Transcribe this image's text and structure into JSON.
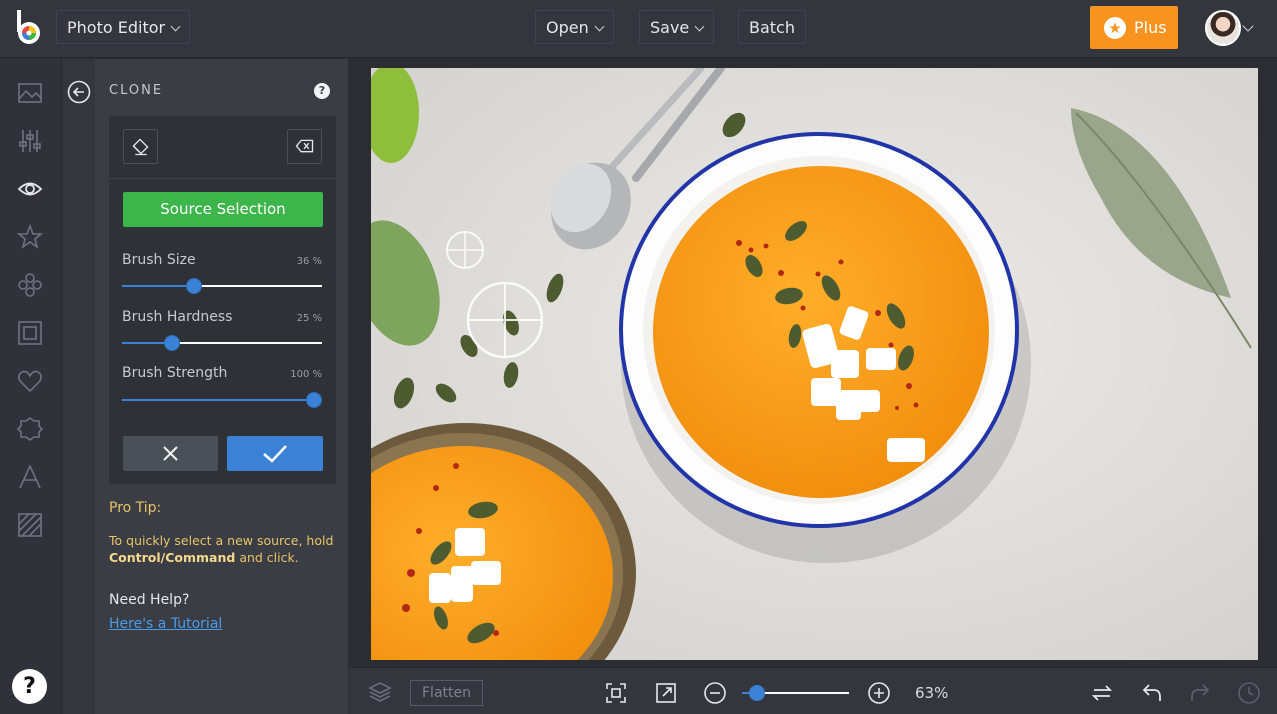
{
  "header": {
    "app_menu": "Photo Editor",
    "open": "Open",
    "save": "Save",
    "batch": "Batch",
    "plus": "Plus"
  },
  "sidebar": {
    "items": [
      {
        "icon": "image-icon"
      },
      {
        "icon": "sliders-icon"
      },
      {
        "icon": "eye-icon",
        "active": true
      },
      {
        "icon": "star-icon"
      },
      {
        "icon": "effects-icon"
      },
      {
        "icon": "frame-icon"
      },
      {
        "icon": "heart-icon"
      },
      {
        "icon": "badge-icon"
      },
      {
        "icon": "text-icon"
      },
      {
        "icon": "texture-icon"
      }
    ],
    "help_label": "?"
  },
  "panel": {
    "title": "CLONE",
    "help_label": "?",
    "source_button": "Source Selection",
    "sliders": [
      {
        "label": "Brush Size",
        "value_text": "36 %",
        "value": 36
      },
      {
        "label": "Brush Hardness",
        "value_text": "25 %",
        "value": 25
      },
      {
        "label": "Brush Strength",
        "value_text": "100 %",
        "value": 100
      }
    ],
    "protip_title": "Pro Tip:",
    "protip_pre": "To quickly select a new source, hold ",
    "protip_bold": "Control/Command",
    "protip_post": " and click.",
    "need_help": "Need Help?",
    "tutorial_link": "Here's a Tutorial"
  },
  "bottombar": {
    "flatten": "Flatten",
    "zoom_value": 63,
    "zoom_text": "63%"
  },
  "colors": {
    "accent": "#3b82d6",
    "green": "#3cb54a",
    "orange": "#f7931e",
    "tip": "#e8c467"
  }
}
